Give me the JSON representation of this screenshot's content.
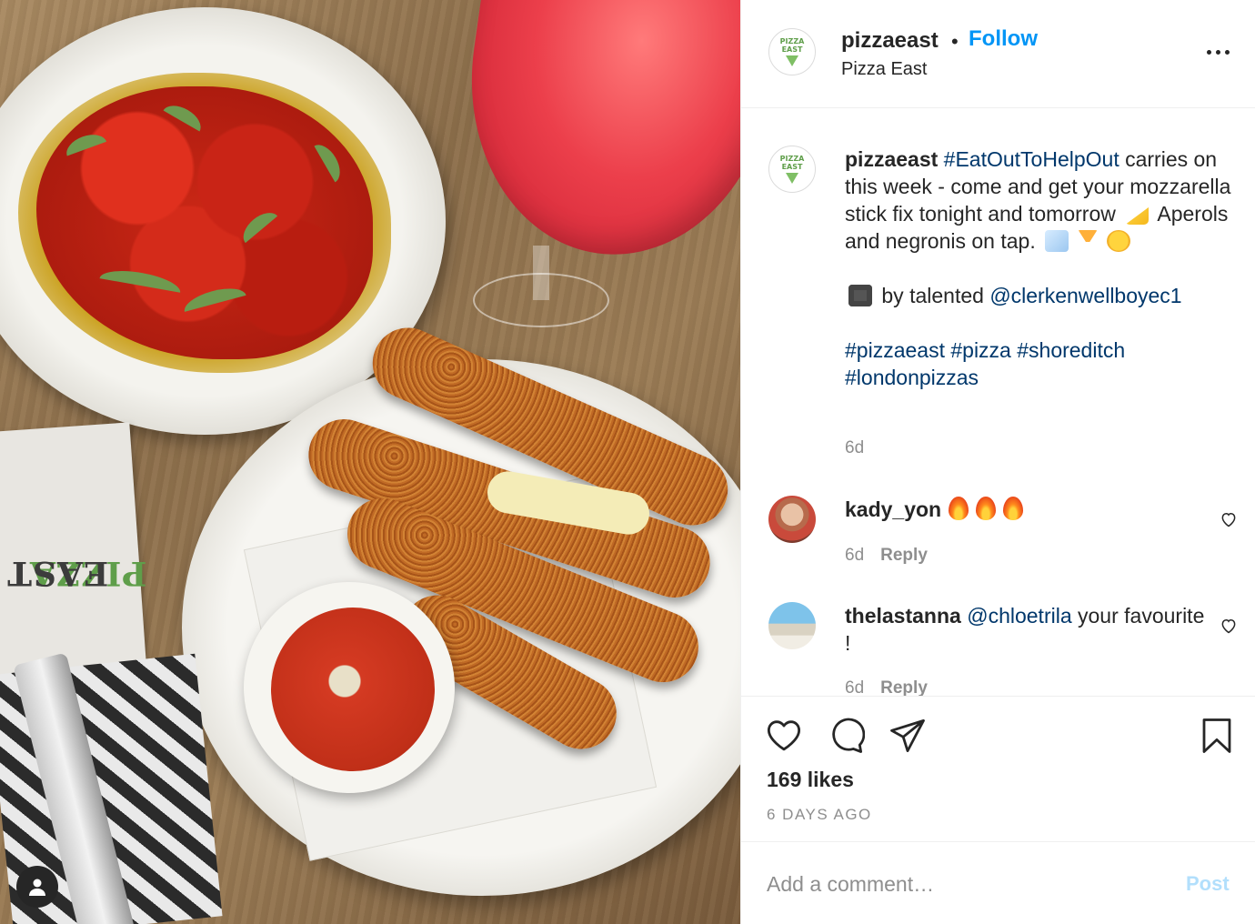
{
  "header": {
    "username": "pizzaeast",
    "separator": "•",
    "follow_label": "Follow",
    "location": "Pizza East",
    "avatar_text": "PIZZA EAST"
  },
  "photo": {
    "menu_logo_top": "PIZZA",
    "menu_logo_bottom": "EAST"
  },
  "caption": {
    "username": "pizzaeast",
    "hashtag_main": "#EatOutToHelpOut",
    "text_1": " carries on this week - come and get your mozzarella stick fix tonight and tomorrow ",
    "text_2": " Aperols and negronis on tap. ",
    "credit_prefix": " by talented ",
    "credit_mention": "@clerkenwellboyec1",
    "tags": [
      "#pizzaeast",
      "#pizza",
      "#shoreditch",
      "#londonpizzas"
    ],
    "time": "6d"
  },
  "comments": [
    {
      "username": "kady_yon",
      "text": "",
      "time": "6d",
      "reply_label": "Reply",
      "flames": 3
    },
    {
      "username": "thelastanna",
      "mention": "@chloetrila",
      "text": " your favourite !",
      "time": "6d",
      "reply_label": "Reply"
    }
  ],
  "actions": {
    "likes": "169 likes",
    "time_ago": "6 DAYS AGO"
  },
  "composer": {
    "placeholder": "Add a comment…",
    "post_label": "Post"
  },
  "colors": {
    "link_blue": "#0095f6",
    "hashtag_navy": "#00376b",
    "muted": "#8e8e8e",
    "post_disabled": "#b2dffc",
    "brand_green": "#5f9e4a"
  }
}
